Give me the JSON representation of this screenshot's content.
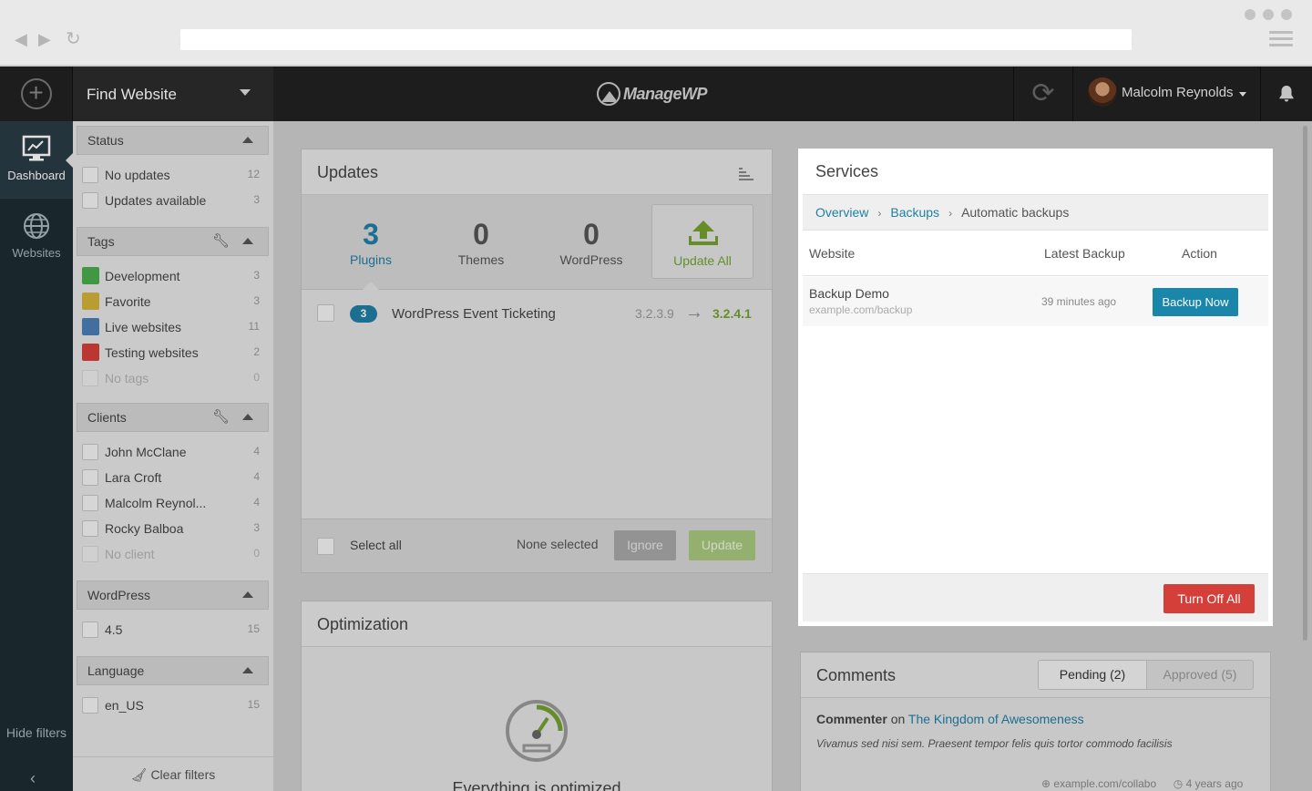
{
  "app": {
    "find_website": "Find Website",
    "logo_text": "ManageWP",
    "user_name": "Malcolm Reynolds"
  },
  "leftnav": {
    "items": [
      {
        "label": "Dashboard",
        "icon": "dashboard-chart-icon"
      },
      {
        "label": "Websites",
        "icon": "globe-icon"
      }
    ],
    "hide_filters": "Hide filters"
  },
  "filters": {
    "status": {
      "title": "Status",
      "items": [
        {
          "label": "No updates",
          "count": "12"
        },
        {
          "label": "Updates available",
          "count": "3"
        }
      ]
    },
    "tags": {
      "title": "Tags",
      "items": [
        {
          "label": "Development",
          "count": "3",
          "color": "#4cae4c"
        },
        {
          "label": "Favorite",
          "count": "3",
          "color": "#d4b33a"
        },
        {
          "label": "Live websites",
          "count": "11",
          "color": "#4a7fb5"
        },
        {
          "label": "Testing websites",
          "count": "2",
          "color": "#d43f3a"
        },
        {
          "label": "No tags",
          "count": "0"
        }
      ]
    },
    "clients": {
      "title": "Clients",
      "items": [
        {
          "label": "John McClane",
          "count": "4"
        },
        {
          "label": "Lara Croft",
          "count": "4"
        },
        {
          "label": "Malcolm Reynol...",
          "count": "4"
        },
        {
          "label": "Rocky Balboa",
          "count": "3"
        },
        {
          "label": "No client",
          "count": "0"
        }
      ]
    },
    "wordpress": {
      "title": "WordPress",
      "items": [
        {
          "label": "4.5",
          "count": "15"
        }
      ]
    },
    "language": {
      "title": "Language",
      "items": [
        {
          "label": "en_US",
          "count": "15"
        }
      ]
    },
    "clear": "Clear filters"
  },
  "updates": {
    "title": "Updates",
    "tabs": [
      {
        "count": "3",
        "label": "Plugins"
      },
      {
        "count": "0",
        "label": "Themes"
      },
      {
        "count": "0",
        "label": "WordPress"
      }
    ],
    "update_all": "Update All",
    "rows": [
      {
        "badge": "3",
        "name": "WordPress Event Ticketing",
        "from": "3.2.3.9",
        "to": "3.2.4.1"
      }
    ],
    "select_all": "Select all",
    "none_selected": "None selected",
    "ignore": "Ignore",
    "update": "Update"
  },
  "optimization": {
    "title": "Optimization",
    "message": "Everything is optimized"
  },
  "services": {
    "title": "Services",
    "breadcrumb": [
      "Overview",
      "Backups",
      "Automatic backups"
    ],
    "columns": [
      "Website",
      "Latest Backup",
      "Action"
    ],
    "rows": [
      {
        "name": "Backup Demo",
        "url": "example.com/backup",
        "latest": "39 minutes ago",
        "action": "Backup Now"
      }
    ],
    "turn_off_all": "Turn Off All"
  },
  "comments": {
    "title": "Comments",
    "tabs": [
      "Pending (2)",
      "Approved (5)"
    ],
    "item": {
      "author": "Commenter",
      "on": "on",
      "post": "The Kingdom of Awesomeness",
      "text": "Vivamus sed nisi sem. Praesent tempor felis quis tortor commodo facilisis",
      "site": "example.com/collabo",
      "time": "4 years ago"
    }
  },
  "colors": {
    "accent": "#1f7fa6",
    "success": "#74a232",
    "danger": "#d43f3a"
  }
}
